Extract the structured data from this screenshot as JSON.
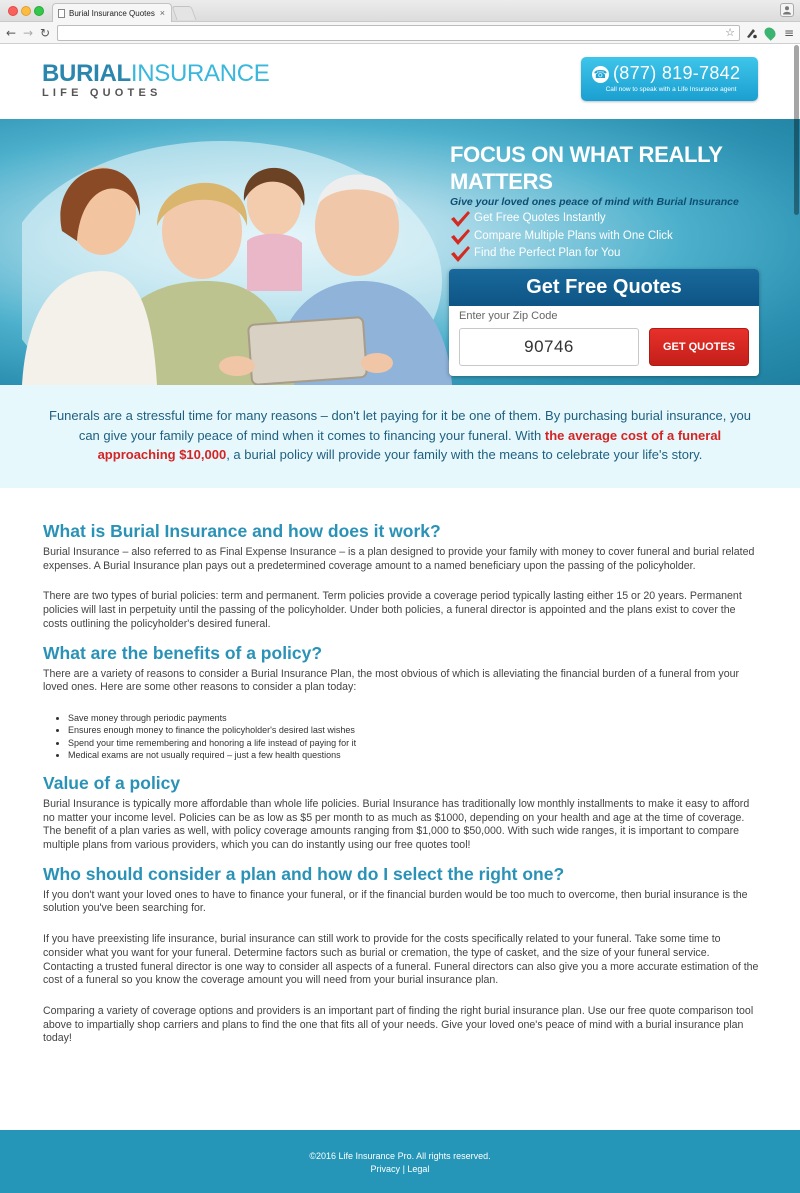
{
  "browser": {
    "tab_title": "Burial Insurance Quotes",
    "tab_close": "×",
    "profile_icon": "person-icon",
    "nav": {
      "back": "←",
      "forward": "→",
      "reload": "↻"
    },
    "star": "☆",
    "menu": "≡"
  },
  "header": {
    "logo_word1": "BURIAL",
    "logo_word2": "INSURANCE",
    "logo_sub": "LIFE QUOTES",
    "phone_number": "(877) 819-7842",
    "phone_sub": "Call now to speak with a Life Insurance agent",
    "phone_icon": "☎"
  },
  "hero": {
    "title": "FOCUS ON WHAT REALLY MATTERS",
    "tagline": "Give your loved ones peace of mind with Burial Insurance",
    "bullets": [
      "Get Free Quotes Instantly",
      "Compare Multiple Plans with One Click",
      "Find the Perfect Plan for You"
    ],
    "quote_box": {
      "heading": "Get Free Quotes",
      "zip_label": "Enter your Zip Code",
      "zip_value": "90746",
      "button_label": "GET QUOTES"
    },
    "colors": {
      "check": "#d42a1f",
      "quote_head": "#135f92",
      "button": "#d9261f"
    }
  },
  "intro": {
    "before": "Funerals are a stressful time for many reasons – don't let paying for it be one of them. By purchasing burial insurance, you can give your family peace of mind when it comes to financing your funeral. With ",
    "highlight": "the average cost of a funeral approaching $10,000",
    "after": ", a burial policy will provide your family with the means to celebrate your life's story."
  },
  "content": {
    "s1_title": "What is Burial Insurance and how does it work?",
    "s1_p1": "Burial Insurance – also referred to as Final Expense Insurance – is a plan designed to provide your family with money to cover funeral and burial related expenses. A Burial Insurance plan pays out a predetermined coverage amount to a named beneficiary upon the passing of the policyholder.",
    "s1_p2": "There are two types of burial policies: term and permanent. Term policies provide a coverage period typically lasting either 15 or 20 years. Permanent policies will last in perpetuity until the passing of the policyholder. Under both policies, a funeral director is appointed and the plans exist to cover the costs outlining the policyholder's desired funeral.",
    "s2_title": "What are the benefits of a policy?",
    "s2_p1": "There are a variety of reasons to consider a Burial Insurance Plan, the most obvious of which is alleviating the financial burden of a funeral from your loved ones. Here are some other reasons to consider a plan today:",
    "s2_list": [
      "Save money through periodic payments",
      "Ensures enough money to finance the policyholder's desired last wishes",
      "Spend your time remembering and honoring a life instead of paying for it",
      "Medical exams are not usually required – just a few health questions"
    ],
    "s3_title": "Value of a policy",
    "s3_p1": "Burial Insurance is typically more affordable than whole life policies. Burial Insurance has traditionally low monthly installments to make it easy to afford no matter your income level. Policies can be as low as $5 per month to as much as $1000, depending on your health and age at the time of coverage. The benefit of a plan varies as well, with policy coverage amounts ranging from $1,000 to $50,000. With such wide ranges, it is important to compare multiple plans from various providers, which you can do instantly using our free quotes tool!",
    "s4_title": "Who should consider a plan and how do I select the right one?",
    "s4_p1": "If you don't want your loved ones to have to finance your funeral, or if the financial burden would be too much to overcome, then burial insurance is the solution you've been searching for.",
    "s4_p2": "If you have preexisting life insurance, burial insurance can still work to provide for the costs specifically related to your funeral. Take some time to consider what you want for your funeral. Determine factors such as burial or cremation, the type of casket, and the size of your funeral service. Contacting a trusted funeral director is one way to consider all aspects of a funeral. Funeral directors can also give you a more accurate estimation of the cost of a funeral so you know the coverage amount you will need from your burial insurance plan.",
    "s4_p3": "Comparing a variety of coverage options and providers is an important part of finding the right burial insurance plan. Use our free quote comparison tool above to impartially shop carriers and plans to find the one that fits all of your needs. Give your loved one's peace of mind with a burial insurance plan today!"
  },
  "footer": {
    "copyright": "©2016  Life Insurance Pro. All rights reserved.",
    "privacy": "Privacy",
    "separator": " | ",
    "legal": "Legal"
  }
}
